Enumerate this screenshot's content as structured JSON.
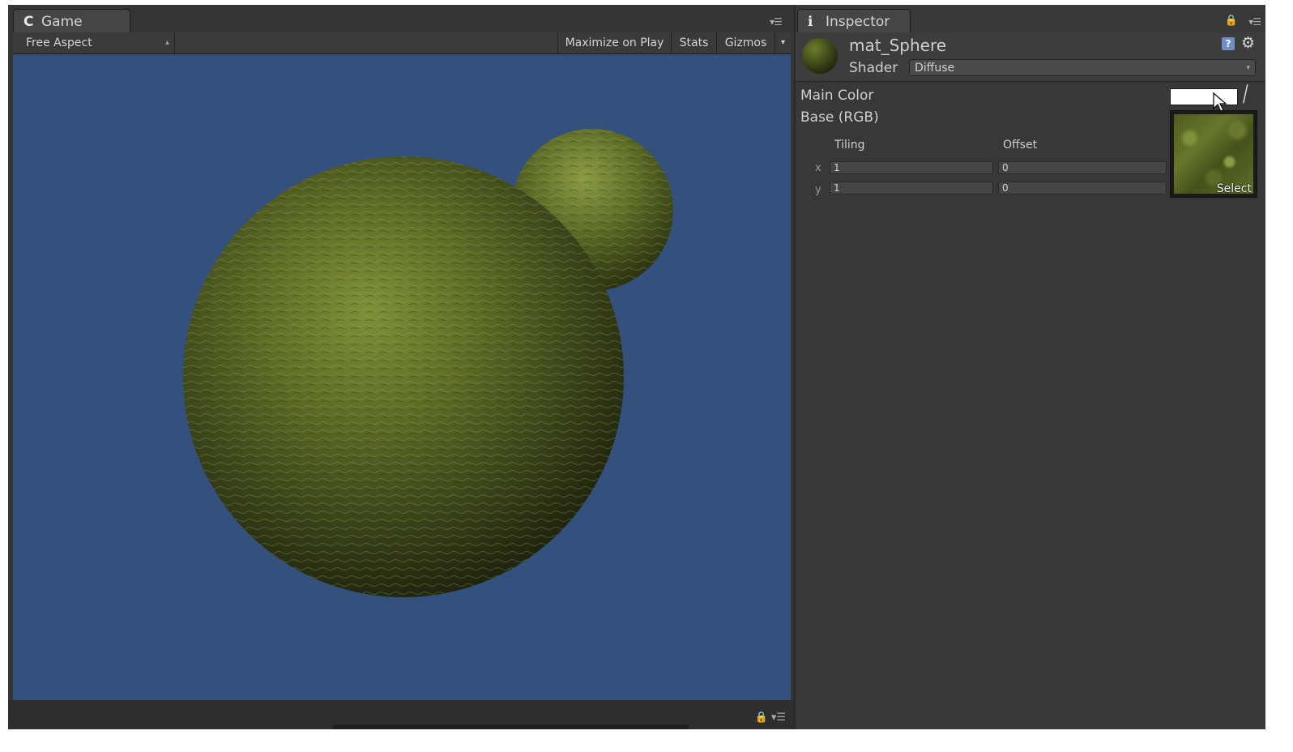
{
  "game": {
    "tab_label": "Game",
    "tab_icon": "unity-game-icon",
    "aspect_dropdown": "Free Aspect",
    "maximize_on_play": "Maximize on Play",
    "stats": "Stats",
    "gizmos": "Gizmos",
    "gizmos_arrow": "▾",
    "viewport_color": "#34507c"
  },
  "inspector": {
    "tab_label": "Inspector",
    "tab_icon": "info-icon",
    "material_name": "mat_Sphere",
    "shader_label": "Shader",
    "shader_value": "Diffuse",
    "main_color_label": "Main Color",
    "main_color_value": "#ffffff",
    "base_label": "Base (RGB)",
    "tiling_label": "Tiling",
    "offset_label": "Offset",
    "x_label": "x",
    "y_label": "y",
    "tiling_x": "1",
    "tiling_y": "1",
    "offset_x": "0",
    "offset_y": "0",
    "select_label": "Select"
  }
}
